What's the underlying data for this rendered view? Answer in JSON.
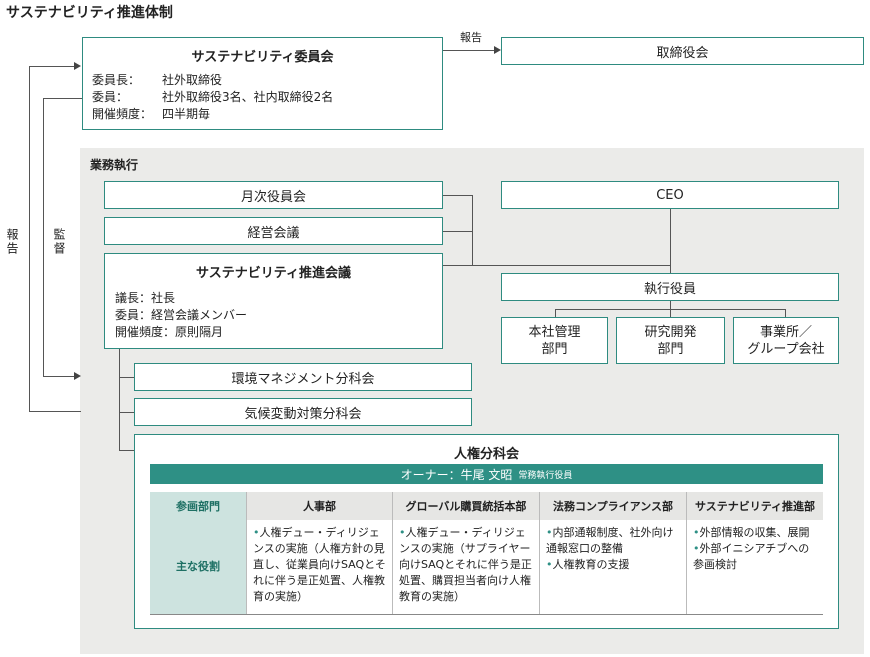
{
  "title": "サステナビリティ推進体制",
  "committee": {
    "title": "サステナビリティ委員会",
    "rows": [
      {
        "label": "委員長：",
        "value": "社外取締役"
      },
      {
        "label": "委員：",
        "value": "社外取締役3名、社内取締役2名"
      },
      {
        "label": "開催頻度：",
        "value": "四半期毎"
      }
    ]
  },
  "board": "取締役会",
  "report_label": "報告",
  "left_report": "報告",
  "left_supervise": "監督",
  "execution_label": "業務執行",
  "monthly_meeting": "月次役員会",
  "management_meeting": "経営会議",
  "promotion": {
    "title": "サステナビリティ推進会議",
    "rows": [
      "議長：社長",
      "委員：経営会議メンバー",
      "開催頻度：原則隔月"
    ]
  },
  "ceo": "CEO",
  "officers": "執行役員",
  "departments": [
    "本社管理\n部門",
    "研究開発\n部門",
    "事業所／\nグループ会社"
  ],
  "env_sub": "環境マネジメント分科会",
  "climate_sub": "気候変動対策分科会",
  "hr_sub": {
    "title": "人権分科会",
    "owner_main": "オーナー：牛尾 文昭",
    "owner_role": "常務執行役員",
    "header_first": "参画部門",
    "columns": [
      "人事部",
      "グローバル購買統括本部",
      "法務コンプライアンス部",
      "サステナビリティ推進部"
    ],
    "row_label": "主な役割",
    "roles": [
      [
        "人権デュー・ディリジェンスの実施（人権方針の見直し、従業員向けSAQとそれに伴う是正処置、人権教育の実施）"
      ],
      [
        "人権デュー・ディリジェンスの実施（サプライヤー向けSAQとそれに伴う是正処置、購買担当者向け人権教育の実施）"
      ],
      [
        "内部通報制度、社外向け通報窓口の整備",
        "人権教育の支援"
      ],
      [
        "外部情報の収集、展開",
        "外部イニシアチブへの参画検討"
      ]
    ]
  }
}
